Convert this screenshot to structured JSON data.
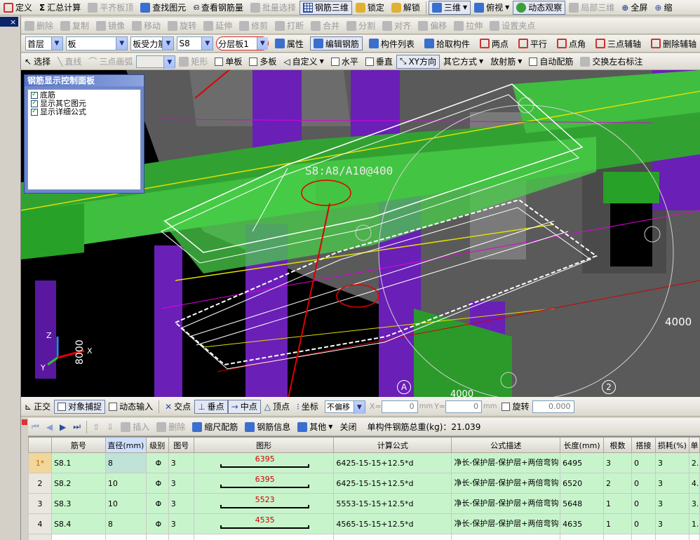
{
  "menubar": {
    "items": [
      "定义",
      "汇总计算",
      "平齐板顶",
      "查找图元",
      "查看钢筋量",
      "批量选择",
      "钢筋三维",
      "锁定",
      "解锁",
      "三维",
      "俯视",
      "动态观察",
      "局部三维",
      "全屏",
      "缩"
    ]
  },
  "edit_toolbar": {
    "items": [
      "删除",
      "复制",
      "镜像",
      "移动",
      "旋转",
      "延伸",
      "修剪",
      "打断",
      "合并",
      "分割",
      "对齐",
      "偏移",
      "拉伸",
      "设置夹点"
    ]
  },
  "prop_toolbar": {
    "floor": "首层",
    "type": "板",
    "rebar_type": "板受力筋",
    "code": "S8",
    "layer": "分层板1",
    "items": [
      "属性",
      "编辑钢筋",
      "构件列表",
      "拾取构件",
      "两点",
      "平行",
      "点角",
      "三点辅轴",
      "删除辅轴"
    ]
  },
  "draw_toolbar": {
    "items": [
      "选择",
      "直线",
      "三点画弧",
      "矩形",
      "单板",
      "多板",
      "自定义",
      "水平",
      "垂直",
      "XY方向",
      "其它方式",
      "放射筋",
      "自动配筋",
      "交换左右标注"
    ]
  },
  "control_panel": {
    "title": "钢筋显示控制面板",
    "items": [
      "底筋",
      "显示其它图元",
      "显示详细公式"
    ]
  },
  "viewport": {
    "rebar_label": "S8:A8/A10@400",
    "dim_right": "4000",
    "dim_axis": "8000",
    "dim_bottom": "4000",
    "axis_a": "A",
    "axis_2": "2",
    "axis_z": "Z",
    "axis_y": "Y",
    "axis_x": "X"
  },
  "status_toolbar": {
    "items": [
      "正交",
      "对象捕捉",
      "动态输入",
      "交点",
      "垂点",
      "中点",
      "顶点",
      "坐标"
    ],
    "offset_mode": "不偏移",
    "x_label": "X=",
    "x_value": "0",
    "y_label": "Y=",
    "y_value": "0",
    "unit": "mm",
    "rotate_label": "旋转",
    "rotate_value": "0.000"
  },
  "rebar_toolbar": {
    "items": [
      "插入",
      "删除",
      "缩尺配筋",
      "钢筋信息",
      "其他",
      "关闭"
    ],
    "total_weight": "单构件钢筋总重(kg)：21.039"
  },
  "table": {
    "headers": [
      "筋号",
      "直径(mm)",
      "级别",
      "图号",
      "图形",
      "计算公式",
      "公式描述",
      "长度(mm)",
      "根数",
      "搭接",
      "损耗(%)",
      "单"
    ],
    "rows": [
      {
        "idx": "1*",
        "name": "S8.1",
        "dia": "8",
        "grade": "Φ",
        "fig": "3",
        "shape": "6395",
        "formula": "6425-15-15+12.5*d",
        "desc": "净长-保护层-保护层+两倍弯钩",
        "len": "6495",
        "count": "3",
        "lap": "0",
        "loss": "3",
        "unit": "2."
      },
      {
        "idx": "2",
        "name": "S8.2",
        "dia": "10",
        "grade": "Φ",
        "fig": "3",
        "shape": "6395",
        "formula": "6425-15-15+12.5*d",
        "desc": "净长-保护层-保护层+两倍弯钩",
        "len": "6520",
        "count": "2",
        "lap": "0",
        "loss": "3",
        "unit": "4."
      },
      {
        "idx": "3",
        "name": "S8.3",
        "dia": "10",
        "grade": "Φ",
        "fig": "3",
        "shape": "5523",
        "formula": "5553-15-15+12.5*d",
        "desc": "净长-保护层-保护层+两倍弯钩",
        "len": "5648",
        "count": "1",
        "lap": "0",
        "loss": "3",
        "unit": "3."
      },
      {
        "idx": "4",
        "name": "S8.4",
        "dia": "8",
        "grade": "Φ",
        "fig": "3",
        "shape": "4535",
        "formula": "4565-15-15+12.5*d",
        "desc": "净长-保护层-保护层+两倍弯钩",
        "len": "4635",
        "count": "1",
        "lap": "0",
        "loss": "3",
        "unit": "1."
      },
      {
        "idx": "5",
        "name": "",
        "dia": "",
        "grade": "",
        "fig": "",
        "shape": "",
        "formula": "",
        "desc": "",
        "len": "",
        "count": "",
        "lap": "",
        "loss": "",
        "unit": ""
      }
    ]
  }
}
